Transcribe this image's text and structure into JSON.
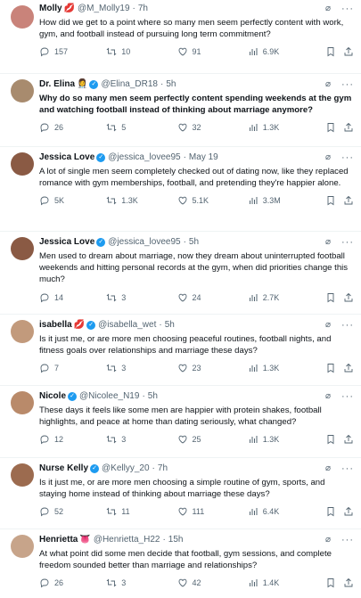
{
  "tweets": [
    {
      "name": "Molly",
      "emoji": "💋",
      "verified": false,
      "handle": "@M_Molly19",
      "time": "7h",
      "text": "How did we get to a point where so many men seem perfectly content with work, gym, and football instead of pursuing long term commitment?",
      "replies": "157",
      "retweets": "10",
      "likes": "91",
      "views": "6.9K",
      "avatar_color": "#c9837a"
    },
    {
      "name": "Dr. Elina",
      "emoji": "👩‍⚕️",
      "verified": true,
      "handle": "@Elina_DR18",
      "time": "5h",
      "text": "Why do so many men seem perfectly content spending weekends at the gym and watching football instead of thinking about marriage anymore?",
      "replies": "26",
      "retweets": "5",
      "likes": "32",
      "views": "1.3K",
      "avatar_color": "#a88b6e"
    },
    {
      "name": "Jessica Love",
      "emoji": "",
      "verified": true,
      "handle": "@jessica_lovee95",
      "time": "May 19",
      "text": "A lot of single men seem completely checked out of dating now, like they replaced romance with gym memberships, football, and pretending they're happier alone.",
      "replies": "5K",
      "retweets": "1.3K",
      "likes": "5.1K",
      "views": "3.3M",
      "avatar_color": "#8a5a44"
    },
    {
      "name": "Jessica Love",
      "emoji": "",
      "verified": true,
      "handle": "@jessica_lovee95",
      "time": "5h",
      "text": "Men used to dream about marriage, now they dream about uninterrupted football weekends and hitting personal records at the gym, when did priorities change this much?",
      "replies": "14",
      "retweets": "3",
      "likes": "24",
      "views": "2.7K",
      "avatar_color": "#8a5a44"
    },
    {
      "name": "isabella",
      "emoji": "💋",
      "verified": true,
      "handle": "@isabella_wet",
      "time": "5h",
      "text": "Is it just me, or are more men choosing peaceful routines, football nights, and fitness goals over relationships and marriage these days?",
      "replies": "7",
      "retweets": "3",
      "likes": "23",
      "views": "1.3K",
      "avatar_color": "#c29a7c"
    },
    {
      "name": "Nicole",
      "emoji": "",
      "verified": true,
      "handle": "@Nicolee_N19",
      "time": "5h",
      "text": "These days it feels like some men are happier with protein shakes, football highlights, and peace at home than dating seriously, what changed?",
      "replies": "12",
      "retweets": "3",
      "likes": "25",
      "views": "1.3K",
      "avatar_color": "#b98a6a"
    },
    {
      "name": "Nurse Kelly",
      "emoji": "",
      "verified": true,
      "handle": "@Kellyy_20",
      "time": "7h",
      "text": "Is it just me, or are more men choosing a simple routine of gym, sports, and staying home instead of thinking about marriage these days?",
      "replies": "52",
      "retweets": "11",
      "likes": "111",
      "views": "6.4K",
      "avatar_color": "#9c6b4f"
    },
    {
      "name": "Henrietta",
      "emoji": "👅",
      "verified": false,
      "handle": "@Henrietta_H22",
      "time": "15h",
      "text": "At what point did some men decide that football, gym sessions, and complete freedom sounded better than marriage and relationships?",
      "replies": "26",
      "retweets": "3",
      "likes": "42",
      "views": "1.4K",
      "avatar_color": "#c7a48a"
    }
  ],
  "colors": {
    "accent": "#1d9bf0",
    "muted": "#536471",
    "text": "#0f1419"
  },
  "icons": [
    "reply-icon",
    "retweet-icon",
    "like-icon",
    "views-icon",
    "bookmark-icon",
    "share-icon",
    "grok-icon",
    "more-icon"
  ]
}
